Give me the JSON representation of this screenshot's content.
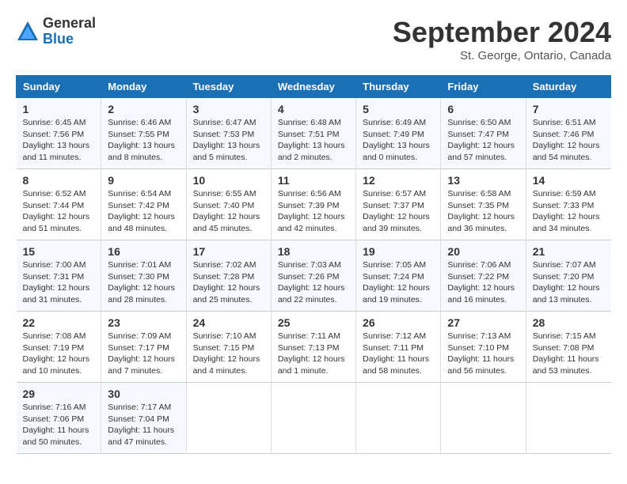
{
  "logo": {
    "general": "General",
    "blue": "Blue"
  },
  "title": "September 2024",
  "location": "St. George, Ontario, Canada",
  "days_of_week": [
    "Sunday",
    "Monday",
    "Tuesday",
    "Wednesday",
    "Thursday",
    "Friday",
    "Saturday"
  ],
  "weeks": [
    [
      {
        "day": "1",
        "sunrise": "6:45 AM",
        "sunset": "7:56 PM",
        "daylight": "13 hours and 11 minutes."
      },
      {
        "day": "2",
        "sunrise": "6:46 AM",
        "sunset": "7:55 PM",
        "daylight": "13 hours and 8 minutes."
      },
      {
        "day": "3",
        "sunrise": "6:47 AM",
        "sunset": "7:53 PM",
        "daylight": "13 hours and 5 minutes."
      },
      {
        "day": "4",
        "sunrise": "6:48 AM",
        "sunset": "7:51 PM",
        "daylight": "13 hours and 2 minutes."
      },
      {
        "day": "5",
        "sunrise": "6:49 AM",
        "sunset": "7:49 PM",
        "daylight": "13 hours and 0 minutes."
      },
      {
        "day": "6",
        "sunrise": "6:50 AM",
        "sunset": "7:47 PM",
        "daylight": "12 hours and 57 minutes."
      },
      {
        "day": "7",
        "sunrise": "6:51 AM",
        "sunset": "7:46 PM",
        "daylight": "12 hours and 54 minutes."
      }
    ],
    [
      {
        "day": "8",
        "sunrise": "6:52 AM",
        "sunset": "7:44 PM",
        "daylight": "12 hours and 51 minutes."
      },
      {
        "day": "9",
        "sunrise": "6:54 AM",
        "sunset": "7:42 PM",
        "daylight": "12 hours and 48 minutes."
      },
      {
        "day": "10",
        "sunrise": "6:55 AM",
        "sunset": "7:40 PM",
        "daylight": "12 hours and 45 minutes."
      },
      {
        "day": "11",
        "sunrise": "6:56 AM",
        "sunset": "7:39 PM",
        "daylight": "12 hours and 42 minutes."
      },
      {
        "day": "12",
        "sunrise": "6:57 AM",
        "sunset": "7:37 PM",
        "daylight": "12 hours and 39 minutes."
      },
      {
        "day": "13",
        "sunrise": "6:58 AM",
        "sunset": "7:35 PM",
        "daylight": "12 hours and 36 minutes."
      },
      {
        "day": "14",
        "sunrise": "6:59 AM",
        "sunset": "7:33 PM",
        "daylight": "12 hours and 34 minutes."
      }
    ],
    [
      {
        "day": "15",
        "sunrise": "7:00 AM",
        "sunset": "7:31 PM",
        "daylight": "12 hours and 31 minutes."
      },
      {
        "day": "16",
        "sunrise": "7:01 AM",
        "sunset": "7:30 PM",
        "daylight": "12 hours and 28 minutes."
      },
      {
        "day": "17",
        "sunrise": "7:02 AM",
        "sunset": "7:28 PM",
        "daylight": "12 hours and 25 minutes."
      },
      {
        "day": "18",
        "sunrise": "7:03 AM",
        "sunset": "7:26 PM",
        "daylight": "12 hours and 22 minutes."
      },
      {
        "day": "19",
        "sunrise": "7:05 AM",
        "sunset": "7:24 PM",
        "daylight": "12 hours and 19 minutes."
      },
      {
        "day": "20",
        "sunrise": "7:06 AM",
        "sunset": "7:22 PM",
        "daylight": "12 hours and 16 minutes."
      },
      {
        "day": "21",
        "sunrise": "7:07 AM",
        "sunset": "7:20 PM",
        "daylight": "12 hours and 13 minutes."
      }
    ],
    [
      {
        "day": "22",
        "sunrise": "7:08 AM",
        "sunset": "7:19 PM",
        "daylight": "12 hours and 10 minutes."
      },
      {
        "day": "23",
        "sunrise": "7:09 AM",
        "sunset": "7:17 PM",
        "daylight": "12 hours and 7 minutes."
      },
      {
        "day": "24",
        "sunrise": "7:10 AM",
        "sunset": "7:15 PM",
        "daylight": "12 hours and 4 minutes."
      },
      {
        "day": "25",
        "sunrise": "7:11 AM",
        "sunset": "7:13 PM",
        "daylight": "12 hours and 1 minute."
      },
      {
        "day": "26",
        "sunrise": "7:12 AM",
        "sunset": "7:11 PM",
        "daylight": "11 hours and 58 minutes."
      },
      {
        "day": "27",
        "sunrise": "7:13 AM",
        "sunset": "7:10 PM",
        "daylight": "11 hours and 56 minutes."
      },
      {
        "day": "28",
        "sunrise": "7:15 AM",
        "sunset": "7:08 PM",
        "daylight": "11 hours and 53 minutes."
      }
    ],
    [
      {
        "day": "29",
        "sunrise": "7:16 AM",
        "sunset": "7:06 PM",
        "daylight": "11 hours and 50 minutes."
      },
      {
        "day": "30",
        "sunrise": "7:17 AM",
        "sunset": "7:04 PM",
        "daylight": "11 hours and 47 minutes."
      },
      null,
      null,
      null,
      null,
      null
    ]
  ],
  "labels": {
    "sunrise": "Sunrise:",
    "sunset": "Sunset:",
    "daylight": "Daylight:"
  }
}
